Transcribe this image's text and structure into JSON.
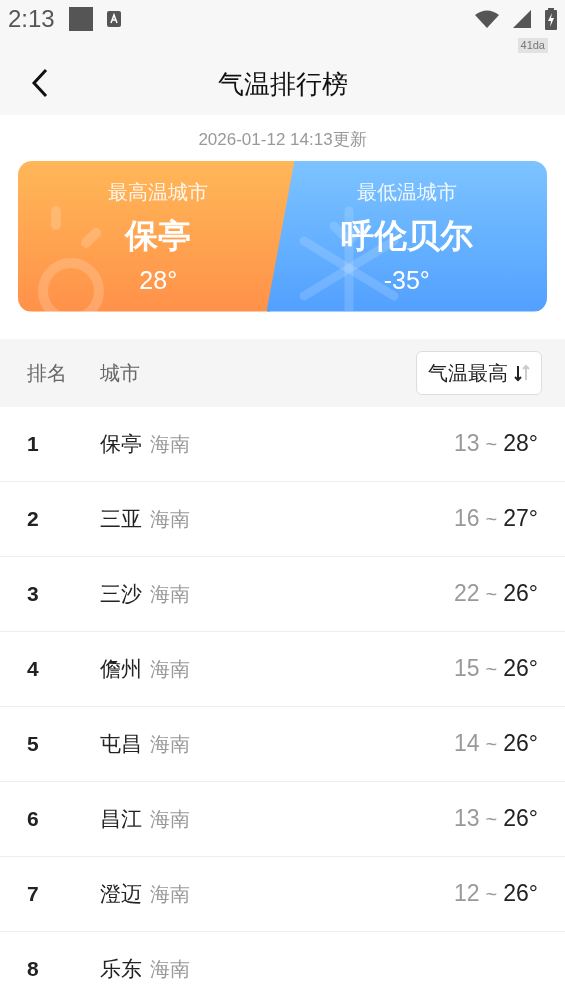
{
  "status_bar": {
    "time": "2:13",
    "badge": "41da"
  },
  "header": {
    "title": "气温排行榜"
  },
  "updated": "2026-01-12 14:13更新",
  "summary": [
    {
      "kind": "hot",
      "label": "最高温城市",
      "city": "保亭",
      "temp": "28°"
    },
    {
      "kind": "cold",
      "label": "最低温城市",
      "city": "呼伦贝尔",
      "temp": "-35°"
    }
  ],
  "table": {
    "columns": [
      "排名",
      "城市"
    ],
    "sort": {
      "label": "气温最高",
      "descending": true
    },
    "rows": [
      {
        "rank": "1",
        "city": "保亭",
        "province": "海南",
        "low": "13",
        "sep": "~",
        "high": "28°"
      },
      {
        "rank": "2",
        "city": "三亚",
        "province": "海南",
        "low": "16",
        "sep": "~",
        "high": "27°"
      },
      {
        "rank": "3",
        "city": "三沙",
        "province": "海南",
        "low": "22",
        "sep": "~",
        "high": "26°"
      },
      {
        "rank": "4",
        "city": "儋州",
        "province": "海南",
        "low": "15",
        "sep": "~",
        "high": "26°"
      },
      {
        "rank": "5",
        "city": "屯昌",
        "province": "海南",
        "low": "14",
        "sep": "~",
        "high": "26°"
      },
      {
        "rank": "6",
        "city": "昌江",
        "province": "海南",
        "low": "13",
        "sep": "~",
        "high": "26°"
      },
      {
        "rank": "7",
        "city": "澄迈",
        "province": "海南",
        "low": "12",
        "sep": "~",
        "high": "26°"
      },
      {
        "rank": "8",
        "city": "乐东",
        "province": "海南"
      }
    ]
  }
}
